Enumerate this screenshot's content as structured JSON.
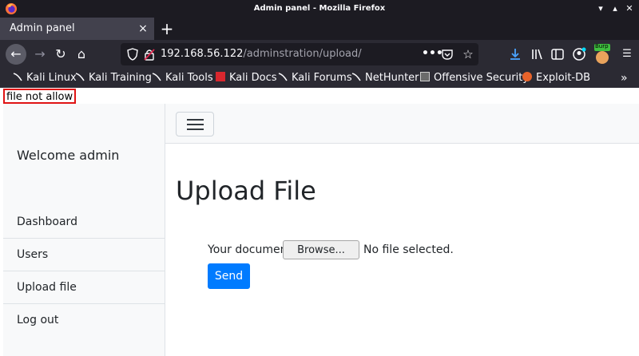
{
  "window": {
    "title": "Admin panel - Mozilla Firefox"
  },
  "tab": {
    "label": "Admin panel",
    "close_glyph": "×"
  },
  "new_tab_glyph": "+",
  "urlbar": {
    "host": "192.168.56.122",
    "path": "/adminstration/upload/",
    "dots": "•••"
  },
  "toolbar_extension_badge": "Burp",
  "bookmarks": [
    {
      "label": "Kali Linux",
      "icon": "kali-dragon-icon"
    },
    {
      "label": "Kali Training",
      "icon": "kali-dragon-icon"
    },
    {
      "label": "Kali Tools",
      "icon": "kali-dragon-icon"
    },
    {
      "label": "Kali Docs",
      "icon": "kali-docs-icon"
    },
    {
      "label": "Kali Forums",
      "icon": "kali-dragon-icon"
    },
    {
      "label": "NetHunter",
      "icon": "kali-dragon-icon"
    },
    {
      "label": "Offensive Security",
      "icon": "offsec-icon"
    },
    {
      "label": "Exploit-DB",
      "icon": "exploitdb-icon"
    }
  ],
  "bookmarks_more": "»",
  "page": {
    "alert": "file not allow",
    "welcome": "Welcome admin",
    "nav": [
      {
        "label": "Dashboard"
      },
      {
        "label": "Users"
      },
      {
        "label": "Upload file"
      },
      {
        "label": "Log out"
      }
    ],
    "title": "Upload File",
    "file_label": "Your document",
    "browse_label": "Browse...",
    "no_file": "No file selected.",
    "send_label": "Send"
  },
  "colors": {
    "primary": "#007bff",
    "alert_border": "#e01414",
    "chrome_dark": "#1c1b22"
  }
}
